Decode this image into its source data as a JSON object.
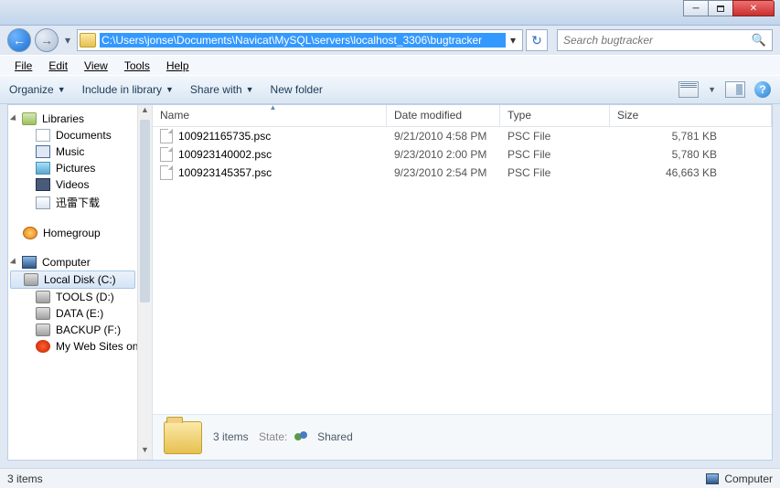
{
  "address": {
    "path": "C:\\Users\\jonse\\Documents\\Navicat\\MySQL\\servers\\localhost_3306\\bugtracker"
  },
  "search": {
    "placeholder": "Search bugtracker"
  },
  "menu": {
    "file": "File",
    "edit": "Edit",
    "view": "View",
    "tools": "Tools",
    "help": "Help"
  },
  "toolbar": {
    "organize": "Organize",
    "include": "Include in library",
    "share": "Share with",
    "newfolder": "New folder"
  },
  "sidebar": {
    "libraries": "Libraries",
    "documents": "Documents",
    "music": "Music",
    "pictures": "Pictures",
    "videos": "Videos",
    "xunlei": "迅雷下载",
    "homegroup": "Homegroup",
    "computer": "Computer",
    "disks": [
      "Local Disk (C:)",
      "TOOLS (D:)",
      "DATA (E:)",
      "BACKUP (F:)",
      "My Web Sites on"
    ]
  },
  "columns": {
    "name": "Name",
    "date": "Date modified",
    "type": "Type",
    "size": "Size"
  },
  "files": [
    {
      "name": "100921165735.psc",
      "date": "9/21/2010 4:58 PM",
      "type": "PSC File",
      "size": "5,781 KB"
    },
    {
      "name": "100923140002.psc",
      "date": "9/23/2010 2:00 PM",
      "type": "PSC File",
      "size": "5,780 KB"
    },
    {
      "name": "100923145357.psc",
      "date": "9/23/2010 2:54 PM",
      "type": "PSC File",
      "size": "46,663 KB"
    }
  ],
  "details": {
    "count": "3 items",
    "state_label": "State:",
    "state_value": "Shared"
  },
  "status": {
    "left": "3 items",
    "right": "Computer"
  }
}
